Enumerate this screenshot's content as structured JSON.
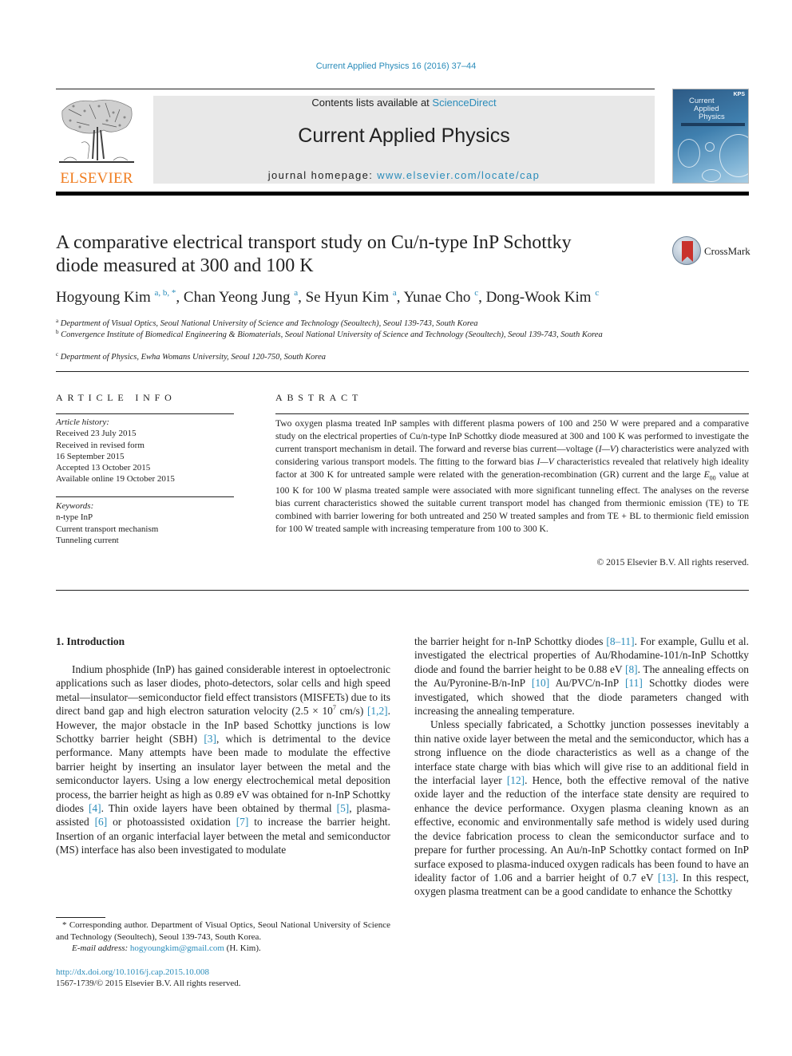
{
  "header": {
    "journal_ref": "Current Applied Physics 16 (2016) 37–44",
    "publisher_logo_text": "ELSEVIER",
    "contents_prefix": "Contents lists available at ",
    "contents_link": "ScienceDirect",
    "journal_title": "Current Applied Physics",
    "homepage_prefix": "journal homepage: ",
    "homepage_link": "www.elsevier.com/locate/cap",
    "cover": {
      "line1": "Current",
      "line2": "Applied",
      "line3": "Physics",
      "badge": "KPS"
    }
  },
  "article": {
    "title_line1": "A comparative electrical transport study on Cu/n-type InP Schottky",
    "title_line2": "diode measured at 300 and 100 K",
    "crossmark_label": "CrossMark",
    "authors": [
      {
        "name": "Hogyoung Kim",
        "affil": "a, b, *"
      },
      {
        "name": "Chan Yeong Jung",
        "affil": "a"
      },
      {
        "name": "Se Hyun Kim",
        "affil": "a"
      },
      {
        "name": "Yunae Cho",
        "affil": "c"
      },
      {
        "name": "Dong-Wook Kim",
        "affil": "c"
      }
    ],
    "affiliations": [
      {
        "mark": "a",
        "text": "Department of Visual Optics, Seoul National University of Science and Technology (Seoultech), Seoul 139-743, South Korea"
      },
      {
        "mark": "b",
        "text": "Convergence Institute of Biomedical Engineering & Biomaterials, Seoul National University of Science and Technology (Seoultech), Seoul 139-743, South Korea"
      },
      {
        "mark": "c",
        "text": "Department of Physics, Ewha Womans University, Seoul 120-750, South Korea"
      }
    ]
  },
  "article_info": {
    "heading": "ARTICLE INFO",
    "history_label": "Article history:",
    "history": [
      "Received 23 July 2015",
      "Received in revised form",
      "16 September 2015",
      "Accepted 13 October 2015",
      "Available online 19 October 2015"
    ],
    "keywords_label": "Keywords:",
    "keywords": [
      "n-type InP",
      "Current transport mechanism",
      "Tunneling current"
    ]
  },
  "abstract": {
    "heading": "ABSTRACT",
    "part1": "Two oxygen plasma treated InP samples with different plasma powers of 100 and 250 W were prepared and a comparative study on the electrical properties of Cu/n-type InP Schottky diode measured at 300 and 100 K was performed to investigate the current transport mechanism in detail. The forward and reverse bias current—voltage (",
    "iv1": "I—V",
    "part2": ") characteristics were analyzed with considering various transport models. The fitting to the forward bias ",
    "iv2": "I—V",
    "part3": " characteristics revealed that relatively high ideality factor at 300 K for untreated sample were related with the generation-recombination (GR) current and the large ",
    "e00_base": "E",
    "e00_sub": "00",
    "part4": " value at 100 K for 100 W plasma treated sample were associated with more significant tunneling effect. The analyses on the reverse bias current characteristics showed the suitable current transport model has changed from thermionic emission (TE) to TE combined with barrier lowering for both untreated and 250 W treated samples and from TE + BL to thermionic field emission for 100 W treated sample with increasing temperature from 100 to 300 K.",
    "copyright": "© 2015 Elsevier B.V. All rights reserved."
  },
  "body": {
    "section_title": "1.  Introduction",
    "left": {
      "s1": "Indium phosphide (InP) has gained considerable interest in optoelectronic applications such as laser diodes, photo-detectors, solar cells and high speed metal—insulator—semiconductor field effect transistors (MISFETs) due to its direct band gap and high electron saturation velocity (2.5 × 10",
      "s1_sup": "7",
      "s2": " cm/s) ",
      "r1": "[1,2]",
      "s3": ". However, the major obstacle in the InP based Schottky junctions is low Schottky barrier height (SBH) ",
      "r2": "[3]",
      "s4": ", which is detrimental to the device performance. Many attempts have been made to modulate the effective barrier height by inserting an insulator layer between the metal and the semiconductor layers. Using a low energy electrochemical metal deposition process, the barrier height as high as 0.89 eV was obtained for n-InP Schottky diodes ",
      "r3": "[4]",
      "s5": ". Thin oxide layers have been obtained by thermal ",
      "r4": "[5]",
      "s6": ", plasma-assisted ",
      "r5": "[6]",
      "s7": " or photoassisted oxidation ",
      "r6": "[7]",
      "s8": " to increase the barrier height. Insertion of an organic interfacial layer between the metal and semiconductor (MS) interface has also been investigated to modulate"
    },
    "right": {
      "p1_a": "the barrier height for n-InP Schottky diodes ",
      "p1_r1": "[8–11]",
      "p1_b": ". For example, Gullu et al. investigated the electrical properties of Au/Rhodamine-101/n-InP Schottky diode and found the barrier height to be 0.88 eV ",
      "p1_r2": "[8]",
      "p1_c": ". The annealing effects on the Au/Pyronine-B/n-InP ",
      "p1_r3": "[10]",
      "p1_d": " Au/PVC/n-InP ",
      "p1_r4": "[11]",
      "p1_e": " Schottky diodes were investigated, which showed that the diode parameters changed with increasing the annealing temperature.",
      "p2_a": "Unless specially fabricated, a Schottky junction possesses inevitably a thin native oxide layer between the metal and the semiconductor, which has a strong influence on the diode characteristics as well as a change of the interface state charge with bias which will give rise to an additional field in the interfacial layer ",
      "p2_r1": "[12]",
      "p2_b": ". Hence, both the effective removal of the native oxide layer and the reduction of the interface state density are required to enhance the device performance. Oxygen plasma cleaning known as an effective, economic and environmentally safe method is widely used during the device fabrication process to clean the semiconductor surface and to prepare for further processing. An Au/n-InP Schottky contact formed on InP surface exposed to plasma-induced oxygen radicals has been found to have an ideality factor of 1.06 and a barrier height of 0.7 eV ",
      "p2_r2": "[13]",
      "p2_c": ". In this respect, oxygen plasma treatment can be a good candidate to enhance the Schottky"
    }
  },
  "footnote": {
    "corresponding": "* Corresponding author. Department of Visual Optics, Seoul National University of Science and Technology (Seoultech), Seoul 139-743, South Korea.",
    "email_label": "E-mail address: ",
    "email": "hogyoungkim@gmail.com",
    "email_suffix": " (H. Kim).",
    "doi": "http://dx.doi.org/10.1016/j.cap.2015.10.008",
    "issn": "1567-1739/© 2015 Elsevier B.V. All rights reserved."
  },
  "colors": {
    "link": "#2a8cba",
    "elsevier_orange": "#f07d20",
    "banner_bg": "#e8e8e8"
  }
}
